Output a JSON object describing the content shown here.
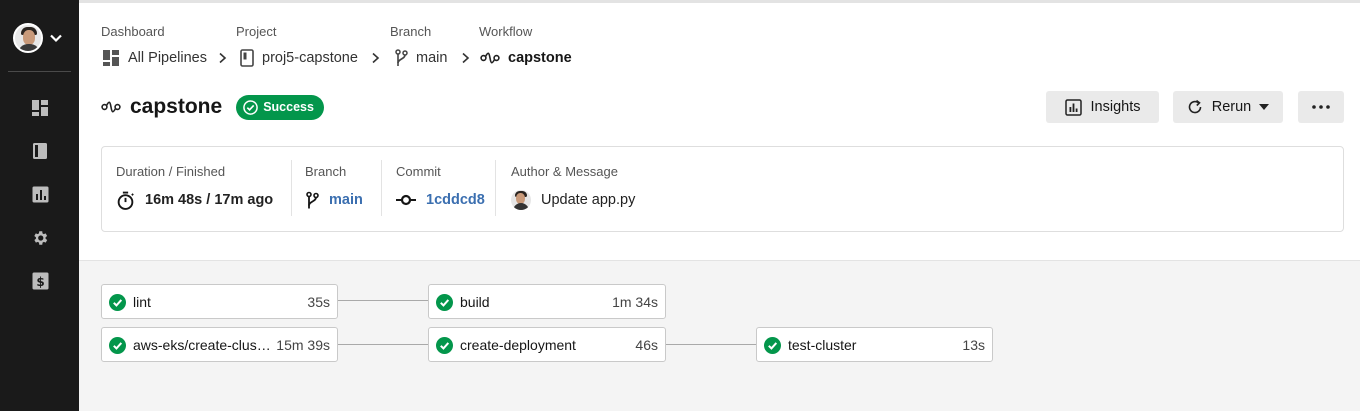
{
  "breadcrumb": {
    "labels": {
      "dashboard": "Dashboard",
      "project": "Project",
      "branch": "Branch",
      "workflow": "Workflow"
    },
    "items": {
      "dashboard": "All Pipelines",
      "project": "proj5-capstone",
      "branch": "main",
      "workflow": "capstone"
    }
  },
  "header": {
    "title": "capstone",
    "status": "Success",
    "insights_label": "Insights",
    "rerun_label": "Rerun"
  },
  "info": {
    "duration": {
      "label": "Duration / Finished",
      "value": "16m 48s / 17m ago"
    },
    "branch": {
      "label": "Branch",
      "value": "main"
    },
    "commit": {
      "label": "Commit",
      "value": "1cddcd8"
    },
    "author": {
      "label": "Author & Message",
      "value": "Update app.py"
    }
  },
  "jobs": [
    {
      "name": "lint",
      "duration": "35s",
      "status": "success"
    },
    {
      "name": "aws-eks/create-clus…",
      "duration": "15m 39s",
      "status": "success"
    },
    {
      "name": "build",
      "duration": "1m 34s",
      "status": "success"
    },
    {
      "name": "create-deployment",
      "duration": "46s",
      "status": "success"
    },
    {
      "name": "test-cluster",
      "duration": "13s",
      "status": "success"
    }
  ],
  "sidebar": {
    "items": [
      "dashboard-icon",
      "projects-icon",
      "insights-icon",
      "settings-icon",
      "plan-icon"
    ]
  },
  "colors": {
    "success": "#03964b",
    "sidebar": "#1a1a1a",
    "link": "#3b6fb0"
  }
}
